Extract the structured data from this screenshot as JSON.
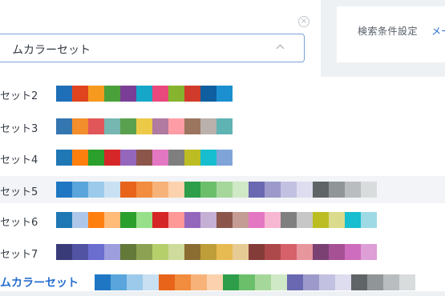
{
  "header": {
    "select_value": "ムカラーセット",
    "close_glyph": "×"
  },
  "right_panel": {
    "label": "検索条件設定",
    "link": "メー"
  },
  "options": [
    {
      "label": "セット2",
      "colors": [
        "#1f6fb8",
        "#e0441f",
        "#f59a1f",
        "#4aa03a",
        "#7a3e96",
        "#16a6c8",
        "#e8487c",
        "#86b42e",
        "#d13b2b",
        "#0f5fa0",
        "#1c8fd0"
      ]
    },
    {
      "label": "セット3",
      "colors": [
        "#3476b0",
        "#f28e2b",
        "#e15759",
        "#76b7b2",
        "#59a14f",
        "#edc948",
        "#b07aa1",
        "#ff9da7",
        "#9c755f",
        "#bab0ac",
        "#5fb3b3"
      ]
    },
    {
      "label": "セット4",
      "colors": [
        "#1f77b4",
        "#ff7f0e",
        "#2ca02c",
        "#d62728",
        "#9467bd",
        "#8c564b",
        "#e377c2",
        "#7f7f7f",
        "#bcbd22",
        "#17becf",
        "#7fa4d8"
      ]
    },
    {
      "label": "セット5",
      "colors": [
        "#1f77c4",
        "#5aa5dc",
        "#9ccaeb",
        "#c8e0f2",
        "#e8641b",
        "#f28c3e",
        "#f7b27a",
        "#fbd2ad",
        "#2e9e4a",
        "#6cbf6a",
        "#a6d79a",
        "#cfe8c6",
        "#6a68b0",
        "#9d9acb",
        "#c3c1e1",
        "#dedcef",
        "#5f6466",
        "#909597",
        "#b9bdbf",
        "#d9dcdd"
      ]
    },
    {
      "label": "セット6",
      "colors": [
        "#1f77b4",
        "#aec7e8",
        "#ff7f0e",
        "#ffbb78",
        "#2ca02c",
        "#98df8a",
        "#d62728",
        "#ff9896",
        "#9467bd",
        "#c5b0d5",
        "#8c564b",
        "#c49c94",
        "#e377c2",
        "#f7b6d2",
        "#7f7f7f",
        "#c7c7c7",
        "#bcbd22",
        "#dbdb8d",
        "#17becf",
        "#9edae5"
      ]
    },
    {
      "label": "セット7",
      "colors": [
        "#393b79",
        "#5254a3",
        "#6b6ecf",
        "#9c9ede",
        "#637939",
        "#8ca252",
        "#b5cf6b",
        "#cedb9c",
        "#8c6d31",
        "#bd9e39",
        "#e7ba52",
        "#e7cb94",
        "#843c39",
        "#ad494a",
        "#d6616b",
        "#e7969c",
        "#7b4173",
        "#a55194",
        "#ce6dbd",
        "#de9ed6"
      ]
    },
    {
      "label": "ムカラーセット",
      "colors": [
        "#1f77c4",
        "#5aa5dc",
        "#9ccaeb",
        "#c8e0f2",
        "#e8641b",
        "#f28c3e",
        "#f7b27a",
        "#fbd2ad",
        "#2e9e4a",
        "#6cbf6a",
        "#a6d79a",
        "#cfe8c6",
        "#6a68b0",
        "#9d9acb",
        "#c3c1e1",
        "#dedcef",
        "#5f6466",
        "#909597",
        "#b9bdbf",
        "#d9dcdd"
      ]
    }
  ]
}
